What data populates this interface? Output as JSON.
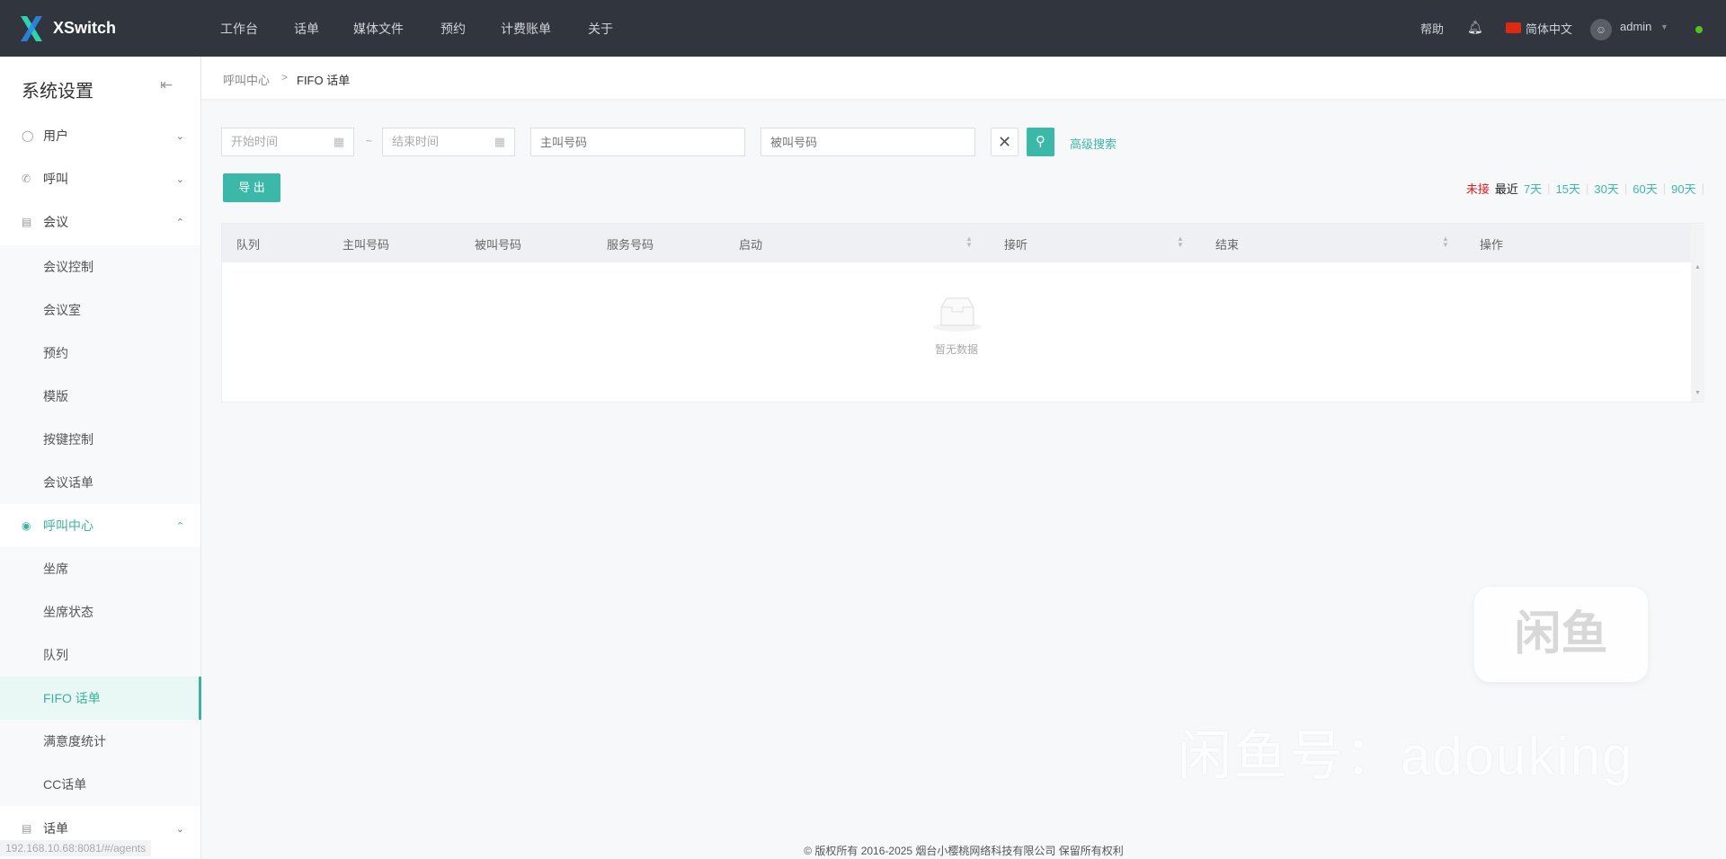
{
  "header": {
    "brand": "XSwitch",
    "nav": [
      "工作台",
      "话单",
      "媒体文件",
      "预约",
      "计费账单",
      "关于"
    ],
    "help": "帮助",
    "language": "简体中文",
    "user": "admin",
    "status_color": "#52c41a"
  },
  "sidebar": {
    "title": "系统设置",
    "items": [
      {
        "label": "用户",
        "icon": "user-icon",
        "expanded": false
      },
      {
        "label": "呼叫",
        "icon": "phone-icon",
        "expanded": false
      },
      {
        "label": "会议",
        "icon": "conference-icon",
        "expanded": true,
        "children": [
          "会议控制",
          "会议室",
          "预约",
          "模版",
          "按键控制",
          "会议话单"
        ]
      },
      {
        "label": "呼叫中心",
        "icon": "call-center-icon",
        "expanded": true,
        "children": [
          "坐席",
          "坐席状态",
          "队列",
          "FIFO 话单",
          "满意度统计",
          "CC话单"
        ],
        "active_child": 3
      },
      {
        "label": "话单",
        "icon": "cdr-icon",
        "expanded": false
      }
    ]
  },
  "breadcrumb": {
    "parent": "呼叫中心",
    "separator": ">",
    "current": "FIFO 话单"
  },
  "filters": {
    "start_placeholder": "开始时间",
    "range_sep": "~",
    "end_placeholder": "结束时间",
    "caller_placeholder": "主叫号码",
    "callee_placeholder": "被叫号码",
    "advanced": "高级搜索"
  },
  "toolbar": {
    "export": "导 出",
    "missed": "未接",
    "recent": "最近",
    "ranges": [
      "7天",
      "15天",
      "30天",
      "60天",
      "90天"
    ]
  },
  "table": {
    "columns": [
      "队列",
      "主叫号码",
      "被叫号码",
      "服务号码",
      "启动",
      "接听",
      "结束",
      "操作"
    ],
    "empty": "暂无数据"
  },
  "footer": "© 版权所有 2016-2025 烟台小樱桃网络科技有限公司 保留所有权利",
  "status_url": "192.168.10.68:8081/#/agents",
  "watermark": {
    "logo": "闲鱼",
    "text": "闲鱼号：adouking"
  },
  "colors": {
    "accent": "#3cb8a9",
    "header": "#31353d",
    "missed": "#e02020"
  }
}
